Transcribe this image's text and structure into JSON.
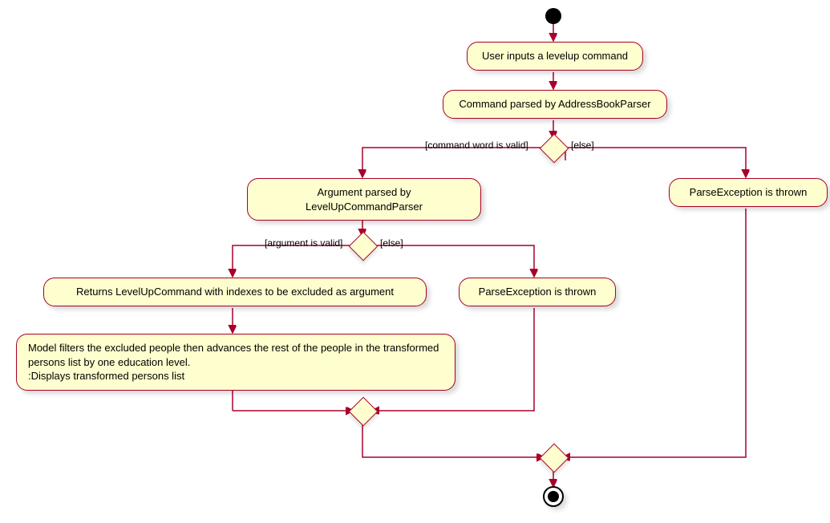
{
  "start": true,
  "nodes": {
    "n1": "User inputs a levelup command",
    "n2": "Command parsed by AddressBookParser",
    "n3": "Argument parsed by LevelUpCommandParser",
    "n4": "Returns LevelUpCommand with indexes to be excluded as argument",
    "n5": "Model filters the excluded people then advances the rest of the people in the transformed persons list by one education level.\n:Displays transformed persons list",
    "n6": "ParseException is thrown",
    "n7": "ParseException is thrown"
  },
  "branch_labels": {
    "b1_left": "[command word is valid]",
    "b1_right": "[else]",
    "b2_left": "[argument is valid]",
    "b2_right": "[else]"
  },
  "chart_data": {
    "type": "activity-diagram",
    "start": "start",
    "end": "end",
    "nodes": [
      {
        "id": "n1",
        "text": "User inputs a levelup command"
      },
      {
        "id": "n2",
        "text": "Command parsed by AddressBookParser"
      },
      {
        "id": "d1",
        "type": "decision"
      },
      {
        "id": "n3",
        "text": "Argument parsed by LevelUpCommandParser"
      },
      {
        "id": "n7",
        "text": "ParseException is thrown"
      },
      {
        "id": "d2",
        "type": "decision"
      },
      {
        "id": "n4",
        "text": "Returns LevelUpCommand with indexes to be excluded as argument"
      },
      {
        "id": "n6",
        "text": "ParseException is thrown"
      },
      {
        "id": "n5",
        "text": "Model filters the excluded people then advances the rest of the people in the transformed persons list by one education level.\n:Displays transformed persons list"
      },
      {
        "id": "m2",
        "type": "merge"
      },
      {
        "id": "m1",
        "type": "merge"
      }
    ],
    "edges": [
      {
        "from": "start",
        "to": "n1"
      },
      {
        "from": "n1",
        "to": "n2"
      },
      {
        "from": "n2",
        "to": "d1"
      },
      {
        "from": "d1",
        "to": "n3",
        "guard": "[command word is valid]"
      },
      {
        "from": "d1",
        "to": "n7",
        "guard": "[else]"
      },
      {
        "from": "n3",
        "to": "d2"
      },
      {
        "from": "d2",
        "to": "n4",
        "guard": "[argument is valid]"
      },
      {
        "from": "d2",
        "to": "n6",
        "guard": "[else]"
      },
      {
        "from": "n4",
        "to": "n5"
      },
      {
        "from": "n5",
        "to": "m2"
      },
      {
        "from": "n6",
        "to": "m2"
      },
      {
        "from": "m2",
        "to": "m1"
      },
      {
        "from": "n7",
        "to": "m1"
      },
      {
        "from": "m1",
        "to": "end"
      }
    ]
  }
}
